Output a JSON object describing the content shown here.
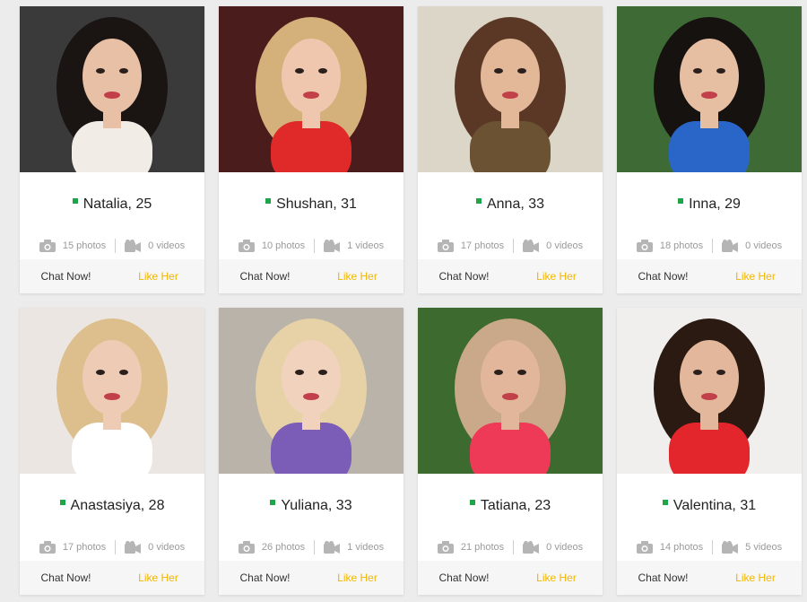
{
  "profiles": [
    {
      "name_age": "Natalia, 25",
      "photos": "15 photos",
      "videos": "0 videos",
      "chat": "Chat Now!",
      "like": "Like Her",
      "bg": "#3a3a3a",
      "skin": "#e8c0a6",
      "hair": "#1a1413",
      "outfit": "#f1ece6"
    },
    {
      "name_age": "Shushan, 31",
      "photos": "10 photos",
      "videos": "1 videos",
      "chat": "Chat Now!",
      "like": "Like Her",
      "bg": "#4a1c1c",
      "skin": "#efc7ae",
      "hair": "#d4b07a",
      "outfit": "#e02a2a"
    },
    {
      "name_age": "Anna, 33",
      "photos": "17 photos",
      "videos": "0 videos",
      "chat": "Chat Now!",
      "like": "Like Her",
      "bg": "#dcd6c8",
      "skin": "#e3b899",
      "hair": "#5a3825",
      "outfit": "#6b5233"
    },
    {
      "name_age": "Inna, 29",
      "photos": "18 photos",
      "videos": "0 videos",
      "chat": "Chat Now!",
      "like": "Like Her",
      "bg": "#3e6a36",
      "skin": "#e6bfa3",
      "hair": "#16120f",
      "outfit": "#2a66c8"
    },
    {
      "name_age": "Anastasiya, 28",
      "photos": "17 photos",
      "videos": "0 videos",
      "chat": "Chat Now!",
      "like": "Like Her",
      "bg": "#ece6e3",
      "skin": "#eecbb4",
      "hair": "#dcbf8c",
      "outfit": "#ffffff"
    },
    {
      "name_age": "Yuliana, 33",
      "photos": "26 photos",
      "videos": "1 videos",
      "chat": "Chat Now!",
      "like": "Like Her",
      "bg": "#b9b3aa",
      "skin": "#f0d2bd",
      "hair": "#e6d2a6",
      "outfit": "#7b5cb6"
    },
    {
      "name_age": "Tatiana, 23",
      "photos": "21 photos",
      "videos": "0 videos",
      "chat": "Chat Now!",
      "like": "Like Her",
      "bg": "#3d6a2f",
      "skin": "#e2b69b",
      "hair": "#c9a98a",
      "outfit": "#ee3a56"
    },
    {
      "name_age": "Valentina, 31",
      "photos": "14 photos",
      "videos": "5 videos",
      "chat": "Chat Now!",
      "like": "Like Her",
      "bg": "#f1efee",
      "skin": "#e3b79b",
      "hair": "#2a1a12",
      "outfit": "#e2262b"
    }
  ],
  "colors": {
    "online": "#1ea449",
    "like": "#f2b600",
    "icon": "#b5b5b5"
  },
  "icons": {
    "photo": "camera-icon",
    "video": "video-camera-icon"
  }
}
